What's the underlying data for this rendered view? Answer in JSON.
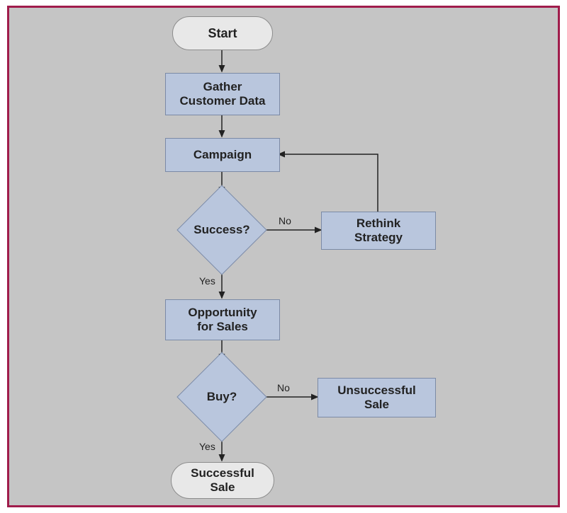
{
  "flowchart": {
    "start": "Start",
    "gather": "Gather\nCustomer Data",
    "campaign": "Campaign",
    "decision_success": "Success?",
    "rethink": "Rethink\nStrategy",
    "opportunity": "Opportunity\nfor Sales",
    "decision_buy": "Buy?",
    "unsuccessful": "Unsuccessful\nSale",
    "successful": "Successful\nSale",
    "label_no1": "No",
    "label_yes1": "Yes",
    "label_no2": "No",
    "label_yes2": "Yes"
  },
  "colors": {
    "frame_border": "#a01c4b",
    "canvas_bg": "#c5c5c5",
    "process_fill": "#b9c6dd",
    "terminator_fill": "#e8e8e8",
    "line": "#222222"
  }
}
